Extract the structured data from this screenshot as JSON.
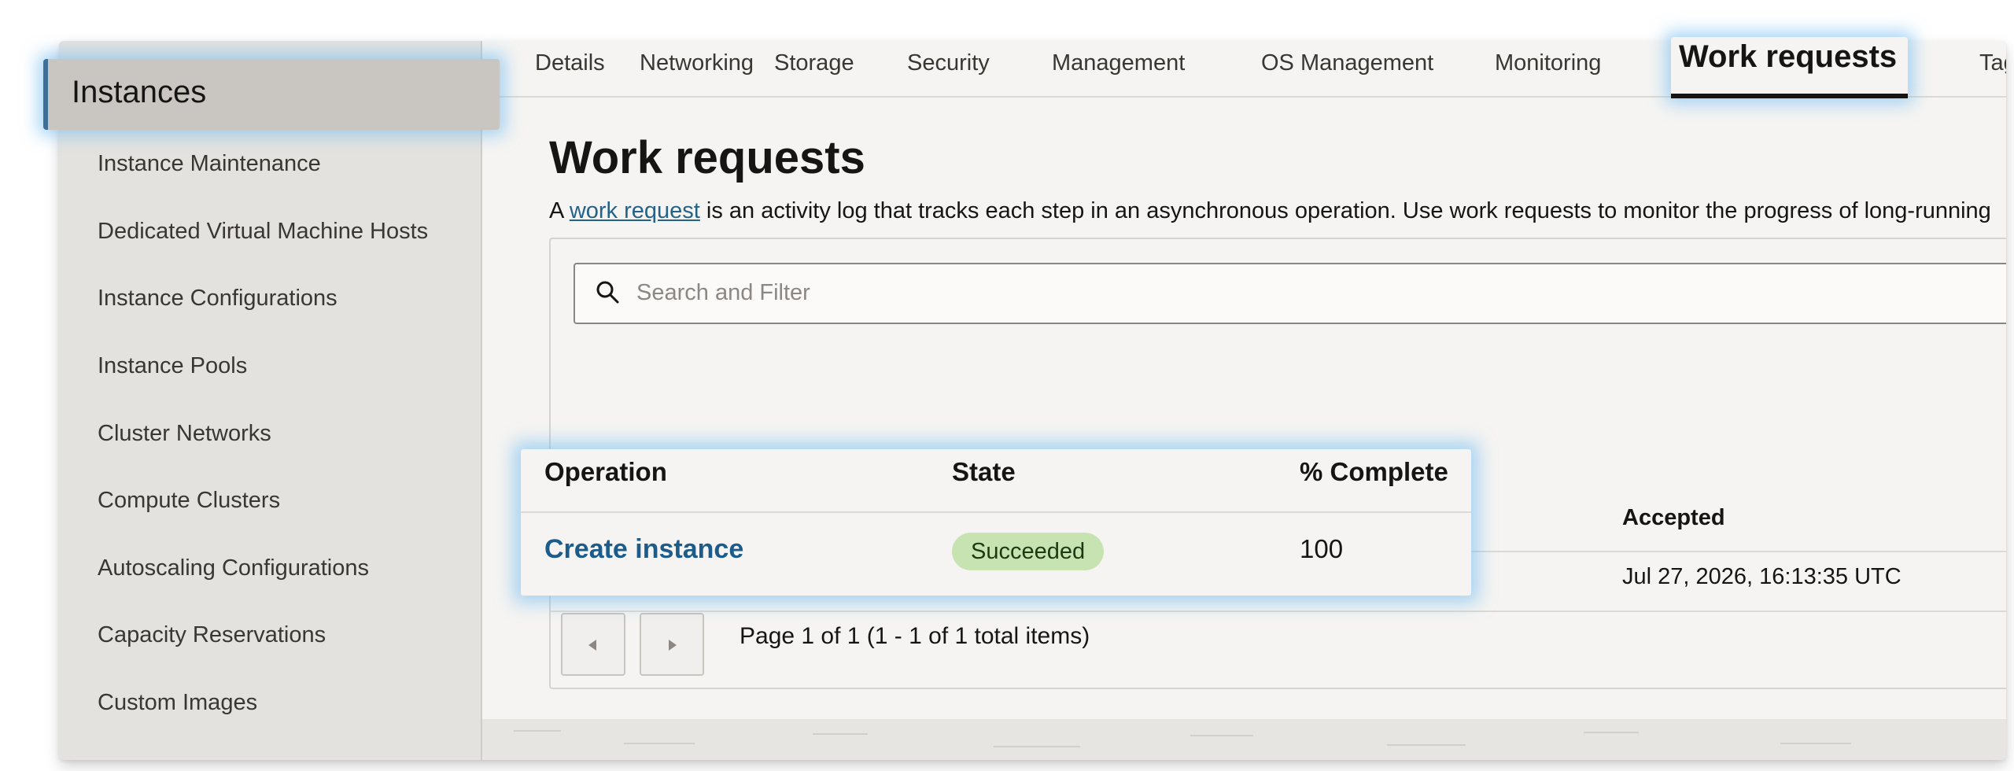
{
  "sidebar": {
    "title": "Instances",
    "items": [
      {
        "label": "Instance Maintenance"
      },
      {
        "label": "Dedicated Virtual Machine Hosts"
      },
      {
        "label": "Instance Configurations"
      },
      {
        "label": "Instance Pools"
      },
      {
        "label": "Cluster Networks"
      },
      {
        "label": "Compute Clusters"
      },
      {
        "label": "Autoscaling Configurations"
      },
      {
        "label": "Capacity Reservations"
      },
      {
        "label": "Custom Images"
      }
    ]
  },
  "tabs": [
    {
      "label": "Details"
    },
    {
      "label": "Networking"
    },
    {
      "label": "Storage"
    },
    {
      "label": "Security"
    },
    {
      "label": "Management"
    },
    {
      "label": "OS Management"
    },
    {
      "label": "Monitoring"
    },
    {
      "label": "Work requests",
      "active": true
    },
    {
      "label": "Tags"
    }
  ],
  "main": {
    "title": "Work requests",
    "description_prefix": "A ",
    "description_link": "work request",
    "description_suffix": " is an activity log that tracks each step in an asynchronous operation. Use work requests to monitor the progress of long-running"
  },
  "search": {
    "placeholder": "Search and Filter",
    "icon": "search-icon"
  },
  "table": {
    "columns": [
      "Operation",
      "State",
      "% Complete",
      "Accepted"
    ],
    "rows": [
      {
        "operation": "Create instance",
        "state": "Succeeded",
        "percent_complete": "100",
        "accepted": "Jul 27, 2026, 16:13:35 UTC"
      }
    ]
  },
  "pagination": {
    "text": "Page 1 of 1 (1 - 1 of 1 total items)",
    "prev_icon": "caret-left-icon",
    "next_icon": "caret-right-icon"
  },
  "colors": {
    "link": "#24628a",
    "success_badge": "#c8e3b2",
    "highlight_glow": "#6eb9f0",
    "active_tab_underline": "#161513"
  }
}
